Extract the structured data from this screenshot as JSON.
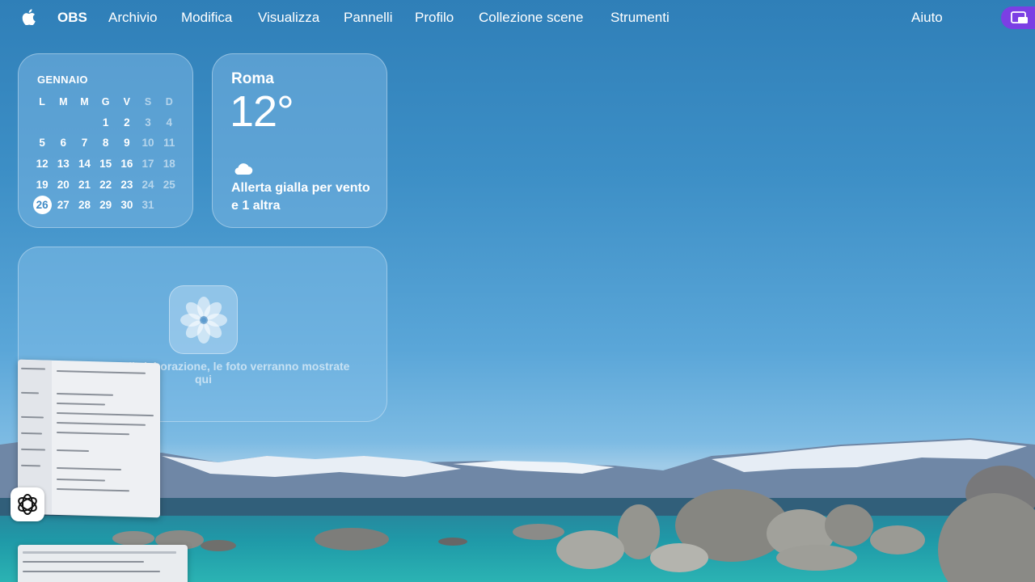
{
  "menubar": {
    "apple_icon": "apple-logo-icon",
    "app_name": "OBS",
    "items": [
      "Archivio",
      "Modifica",
      "Visualizza",
      "Pannelli",
      "Profilo",
      "Collezione scene",
      "Strumenti"
    ],
    "help": "Aiuto",
    "status_icon": "screen-recording-icon"
  },
  "calendar": {
    "month": "GENNAIO",
    "weekdays": [
      "L",
      "M",
      "M",
      "G",
      "V",
      "S",
      "D"
    ],
    "weeks": [
      [
        "",
        "",
        "",
        "1",
        "2",
        "3",
        "4"
      ],
      [
        "5",
        "6",
        "7",
        "8",
        "9",
        "10",
        "11"
      ],
      [
        "12",
        "13",
        "14",
        "15",
        "16",
        "17",
        "18"
      ],
      [
        "19",
        "20",
        "21",
        "22",
        "23",
        "24",
        "25"
      ],
      [
        "26",
        "27",
        "28",
        "29",
        "30",
        "31",
        ""
      ]
    ],
    "today": "26"
  },
  "weather": {
    "city": "Roma",
    "temperature": "12°",
    "condition_icon": "cloud-icon",
    "description": "Allerta gialla per vento e 1 altra"
  },
  "photos": {
    "icon": "photos-flower-icon",
    "message": "Al termine dell'elaborazione, le foto verranno mostrate qui"
  },
  "dock_thumbnails": {
    "app_icon": "chatgpt-icon"
  },
  "colors": {
    "sky_top": "#2f7fb8",
    "status_accent": "#7b3fe4",
    "today_text": "#3f8bc6"
  }
}
